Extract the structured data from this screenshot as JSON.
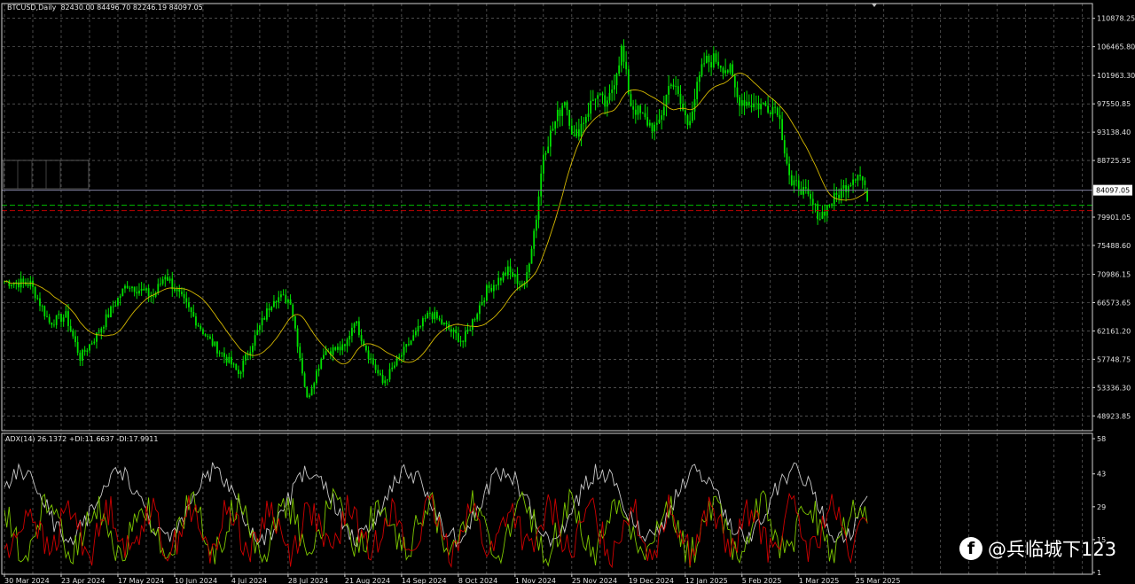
{
  "header": {
    "main_label": "BTCUSD,Daily  82430.00 84496.70 82246.19 84097.05",
    "indicator_label": "ADX(14) 26.1372 +DI:11.6637 -DI:17.9911"
  },
  "watermark": {
    "icon": "facebook-icon",
    "text": "@兵临城下123"
  },
  "colors": {
    "background": "#000000",
    "candle_up": "#00e000",
    "candle_down": "#00e000",
    "ma_line": "#d4b800",
    "adx_line": "#c8c8c8",
    "plus_di_line": "#7ec800",
    "minus_di_line": "#d00000",
    "grid": "#7a7a7a",
    "current_price_line": "#8080a0",
    "level_line_green": "#00c000",
    "level_line_red": "#c00000"
  },
  "chart_data": [
    {
      "type": "candlestick",
      "symbol": "BTCUSD",
      "timeframe": "Daily",
      "ohlc_last": {
        "open": 82430.0,
        "high": 84496.7,
        "low": 82246.19,
        "close": 84097.05
      },
      "current_price_label": "84097.05",
      "ylim": [
        46617.22,
        113182.3
      ],
      "ytick_values": [
        110878.25,
        106465.8,
        101963.3,
        97550.85,
        93138.4,
        88725.95,
        79901.05,
        75488.6,
        70986.15,
        66573.65,
        62161.2,
        57748.75,
        53336.3,
        48923.85
      ],
      "ytick_labels": [
        "110878.25",
        "106465.80",
        "101963.30",
        "97550.85",
        "93138.40",
        "88725.95",
        "79901.05",
        "75488.60",
        "70986.15",
        "66573.65",
        "62161.20",
        "57748.75",
        "53336.30",
        "48923.85"
      ],
      "xtick_labels": [
        "30 Mar 2024",
        "23 Apr 2024",
        "17 May 2024",
        "10 Jun 2024",
        "4 Jul 2024",
        "28 Jul 2024",
        "21 Aug 2024",
        "14 Sep 2024",
        "8 Oct 2024",
        "1 Nov 2024",
        "25 Nov 2024",
        "19 Dec 2024",
        "12 Jan 2025",
        "5 Feb 2025",
        "1 Mar 2025",
        "25 Mar 2025"
      ],
      "close_anchors": [
        [
          "30 Mar 2024",
          69900
        ],
        [
          "10 Apr 2024",
          69500
        ],
        [
          "18 Apr 2024",
          63500
        ],
        [
          "25 Apr 2024",
          64500
        ],
        [
          "1 May 2024",
          58000
        ],
        [
          "8 May 2024",
          61500
        ],
        [
          "15 May 2024",
          66000
        ],
        [
          "21 May 2024",
          69500
        ],
        [
          "1 Jun 2024",
          67500
        ],
        [
          "6 Jun 2024",
          71000
        ],
        [
          "15 Jun 2024",
          66000
        ],
        [
          "24 Jun 2024",
          61000
        ],
        [
          "4 Jul 2024",
          57000
        ],
        [
          "7 Jul 2024",
          55500
        ],
        [
          "15 Jul 2024",
          62000
        ],
        [
          "22 Jul 2024",
          67500
        ],
        [
          "29 Jul 2024",
          67000
        ],
        [
          "5 Aug 2024",
          51500
        ],
        [
          "12 Aug 2024",
          59000
        ],
        [
          "21 Aug 2024",
          59500
        ],
        [
          "25 Aug 2024",
          64000
        ],
        [
          "31 Aug 2024",
          58500
        ],
        [
          "6 Sep 2024",
          54000
        ],
        [
          "15 Sep 2024",
          59000
        ],
        [
          "26 Sep 2024",
          65000
        ],
        [
          "10 Oct 2024",
          60500
        ],
        [
          "20 Oct 2024",
          68500
        ],
        [
          "29 Oct 2024",
          71500
        ],
        [
          "5 Nov 2024",
          69000
        ],
        [
          "10 Nov 2024",
          80000
        ],
        [
          "13 Nov 2024",
          90000
        ],
        [
          "22 Nov 2024",
          98500
        ],
        [
          "26 Nov 2024",
          92000
        ],
        [
          "5 Dec 2024",
          99000
        ],
        [
          "10 Dec 2024",
          97000
        ],
        [
          "16 Dec 2024",
          106000
        ],
        [
          "20 Dec 2024",
          97500
        ],
        [
          "26 Dec 2024",
          95000
        ],
        [
          "31 Dec 2024",
          93500
        ],
        [
          "6 Jan 2025",
          101500
        ],
        [
          "13 Jan 2025",
          94500
        ],
        [
          "20 Jan 2025",
          104000
        ],
        [
          "25 Jan 2025",
          104500
        ],
        [
          "31 Jan 2025",
          102500
        ],
        [
          "3 Feb 2025",
          98500
        ],
        [
          "10 Feb 2025",
          97500
        ],
        [
          "20 Feb 2025",
          97000
        ],
        [
          "26 Feb 2025",
          84500
        ],
        [
          "1 Mar 2025",
          85000
        ],
        [
          "10 Mar 2025",
          80000
        ],
        [
          "13 Mar 2025",
          81500
        ],
        [
          "19 Mar 2025",
          84000
        ],
        [
          "26 Mar 2025",
          87000
        ],
        [
          "30 Mar 2025",
          84097
        ]
      ]
    },
    {
      "type": "line",
      "title": "ADX(14)",
      "values_last": {
        "adx": 26.1372,
        "plus_di": 11.6637,
        "minus_di": 17.9911
      },
      "ylim": [
        1,
        58
      ],
      "ytick_values": [
        58,
        43,
        29,
        15,
        1
      ],
      "ytick_labels": [
        "58",
        "43",
        "29",
        "15",
        "1"
      ],
      "series": [
        {
          "name": "ADX(14)",
          "color": "#c8c8c8"
        },
        {
          "name": "+DI",
          "color": "#7ec800"
        },
        {
          "name": "-DI",
          "color": "#d00000"
        }
      ]
    }
  ]
}
